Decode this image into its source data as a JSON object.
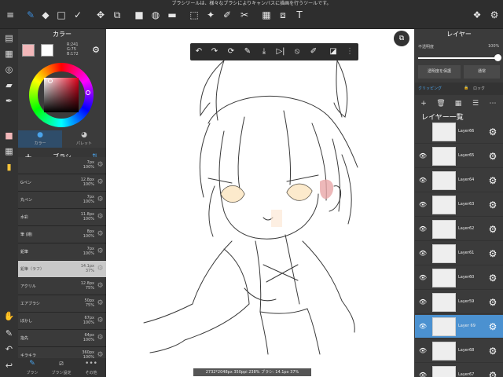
{
  "hint_text": "ブラシツールは、様々なブラシによりキャンバスに描画を行うツールです。",
  "toolbar": {
    "menu_icon": "≡",
    "brush_icon": "✎",
    "eraser_icon": "◆",
    "rect_icon": "□",
    "check_icon": "✓",
    "move_icon": "✥",
    "transform_icon": "⧉",
    "fill_rect_icon": "■",
    "bucket_icon": "◍",
    "gradient_icon": "▬",
    "select_icon": "⬚",
    "magic_icon": "✦",
    "pen_select_icon": "✐",
    "eraser_select_icon": "✂",
    "frame_icon": "▦",
    "frame2_icon": "⧈",
    "text_icon": "T",
    "materials_icon": "❖",
    "settings_icon": "⚙"
  },
  "left_tools": [
    "▤",
    "▦",
    "◎",
    "▰",
    "✒",
    "■",
    "▦",
    "▮",
    "✋",
    "✎",
    "↶",
    "↩"
  ],
  "color_panel": {
    "title": "カラー",
    "primary_color": "#f2b7b9",
    "secondary_color": "#ffffff",
    "rgb_r": "R:241",
    "rgb_g": "G:75",
    "rgb_b": "B:172",
    "tab_color": "カラー",
    "tab_palette": "パレット"
  },
  "brush_panel": {
    "title": "ブラシ",
    "add_icon": "+",
    "sort_icon": "⇅",
    "brushes": [
      {
        "name": "",
        "size": "7px",
        "opacity": "100%"
      },
      {
        "name": "Gペン",
        "size": "12.8px",
        "opacity": "100%"
      },
      {
        "name": "丸ペン",
        "size": "7px",
        "opacity": "100%"
      },
      {
        "name": "水彩",
        "size": "11.8px",
        "opacity": "100%"
      },
      {
        "name": "筆 (雑)",
        "size": "8px",
        "opacity": "100%"
      },
      {
        "name": "鉛筆",
        "size": "7px",
        "opacity": "100%"
      },
      {
        "name": "鉛筆（ラフ）",
        "size": "14.1px",
        "opacity": "37%"
      },
      {
        "name": "アクリル",
        "size": "12.8px",
        "opacity": "75%"
      },
      {
        "name": "エアブラシ",
        "size": "50px",
        "opacity": "75%"
      },
      {
        "name": "ぼかし",
        "size": "67px",
        "opacity": "100%"
      },
      {
        "name": "指先",
        "size": "64px",
        "opacity": "100%"
      },
      {
        "name": "キラキラ",
        "size": "360px",
        "opacity": "100%"
      }
    ],
    "selected_index": 6
  },
  "bottom_left": {
    "tab_brush": "ブラシ",
    "tab_settings": "ブラシ設定",
    "tab_other": "その他"
  },
  "canvas": {
    "status": "2732*2048px 350ppi 238% ブラシ: 14.1px 37%"
  },
  "float_bar": [
    "↶",
    "↷",
    "⟳",
    "✎",
    "⤓",
    "▷|",
    "⦸",
    "✐",
    "◪",
    "⋮"
  ],
  "layer_panel": {
    "title": "レイヤー",
    "opacity_label": "不透明度",
    "opacity_value": "100%",
    "opacity_fraction": 1.0,
    "clip_button": "透明度を保護",
    "blend_button": "通常",
    "lock_label": "ロック",
    "clipping_label": "クリッピング",
    "list_title": "レイヤー一覧",
    "layers": [
      {
        "name": "Layer66",
        "visible": false
      },
      {
        "name": "Layer65",
        "visible": true
      },
      {
        "name": "Layer64",
        "visible": true
      },
      {
        "name": "Layer63",
        "visible": true
      },
      {
        "name": "Layer62",
        "visible": true
      },
      {
        "name": "Layer61",
        "visible": true
      },
      {
        "name": "Layer60",
        "visible": true
      },
      {
        "name": "Layer59",
        "visible": true
      },
      {
        "name": "Layer 69",
        "visible": true
      },
      {
        "name": "Layer68",
        "visible": true
      },
      {
        "name": "Layer67",
        "visible": true
      }
    ],
    "selected_index": 8
  }
}
